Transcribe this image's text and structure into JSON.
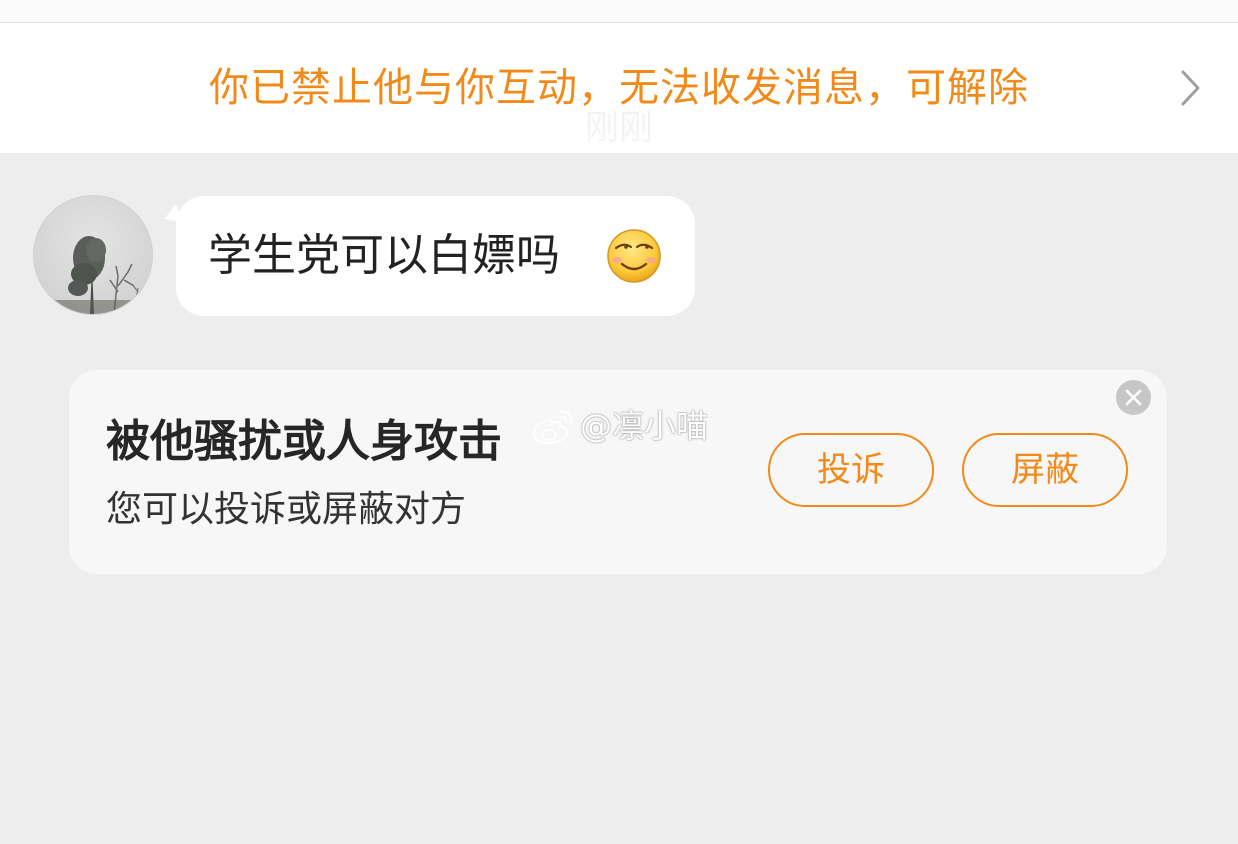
{
  "notice": {
    "text": "你已禁止他与你互动，无法收发消息，可解除",
    "color": "#f28a1a"
  },
  "timestamp": "刚刚",
  "message": {
    "text": "学生党可以白嫖吗",
    "emoji": "smirk-smile-emoji"
  },
  "card": {
    "title": "被他骚扰或人身攻击",
    "subtitle": "您可以投诉或屏蔽对方",
    "report_label": "投诉",
    "block_label": "屏蔽"
  },
  "watermark": {
    "text": "@凛小喵",
    "icon": "weibo-icon"
  },
  "colors": {
    "accent": "#f28a1a",
    "background": "#ededed",
    "bubble": "#ffffff",
    "card": "#f7f7f7"
  }
}
